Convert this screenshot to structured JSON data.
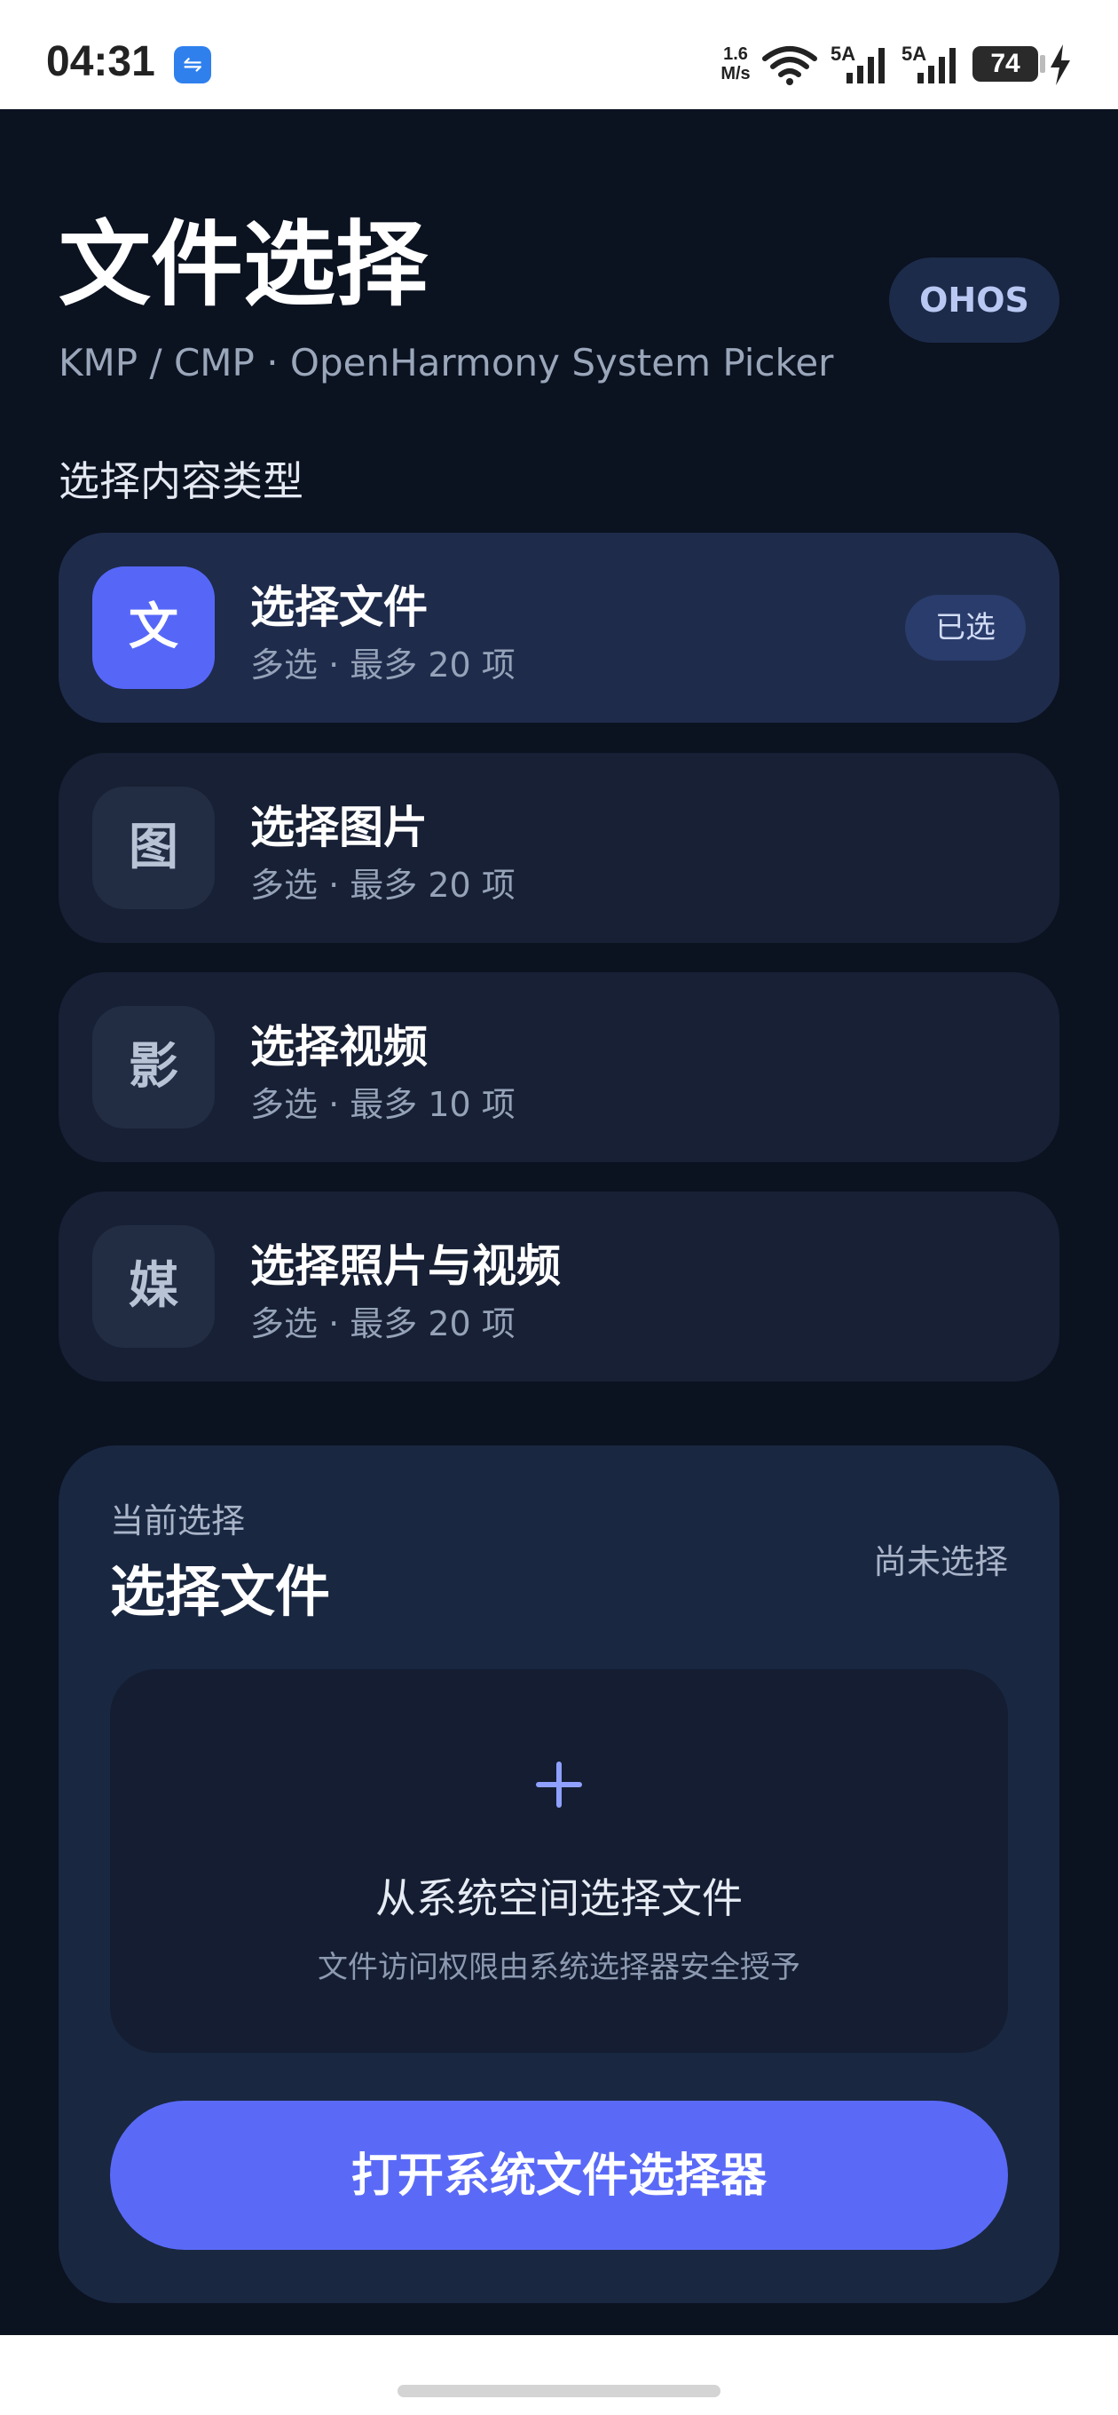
{
  "status_bar": {
    "time": "04:31",
    "usb_icon": "usb-icon",
    "net_speed_value": "1.6",
    "net_speed_unit": "M/s",
    "signal_1_label": "5A",
    "signal_2_label": "5A",
    "battery": "74"
  },
  "header": {
    "title": "文件选择",
    "subtitle": "KMP / CMP · OpenHarmony System Picker",
    "badge": "OHOS"
  },
  "section_label": "选择内容类型",
  "options": [
    {
      "icon_char": "文",
      "title": "选择文件",
      "desc": "多选 · 最多 20 项",
      "selected": true,
      "selected_label": "已选"
    },
    {
      "icon_char": "图",
      "title": "选择图片",
      "desc": "多选 · 最多 20 项",
      "selected": false
    },
    {
      "icon_char": "影",
      "title": "选择视频",
      "desc": "多选 · 最多 10 项",
      "selected": false
    },
    {
      "icon_char": "媒",
      "title": "选择照片与视频",
      "desc": "多选 · 最多 20 项",
      "selected": false
    }
  ],
  "current": {
    "label": "当前选择",
    "value": "选择文件",
    "status": "尚未选择",
    "drop_title": "从系统空间选择文件",
    "drop_hint": "文件访问权限由系统选择器安全授予",
    "button_label": "打开系统文件选择器"
  },
  "colors": {
    "background": "#0b1220",
    "card": "#172034",
    "card_selected": "#1e2b4b",
    "accent": "#5a6af7"
  }
}
